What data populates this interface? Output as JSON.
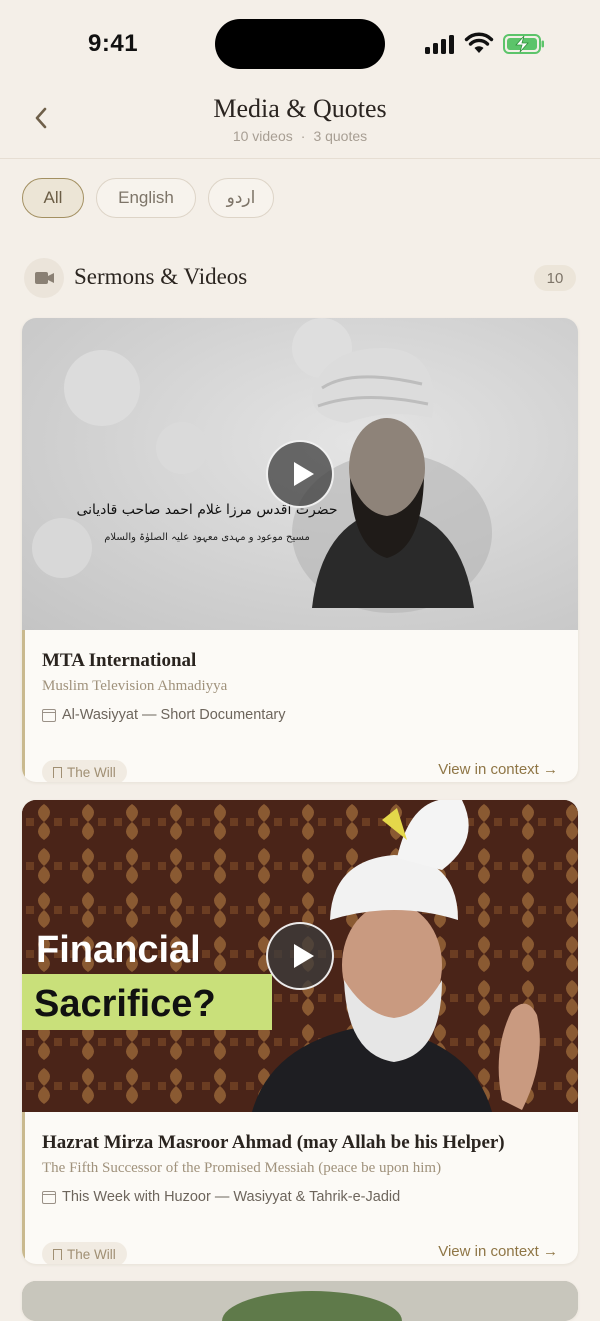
{
  "status": {
    "time": "9:41"
  },
  "header": {
    "title": "Media & Quotes",
    "videos_count": "10 videos",
    "separator": "·",
    "quotes_count": "3 quotes"
  },
  "filters": [
    {
      "label": "All",
      "active": true
    },
    {
      "label": "English",
      "active": false
    },
    {
      "label": "اردو",
      "active": false
    }
  ],
  "section": {
    "icon": "video-camera-icon",
    "title": "Sermons & Videos",
    "count": "10"
  },
  "cards": [
    {
      "title": "MTA International",
      "subtitle": "Muslim Television Ahmadiyya",
      "program": "Al-Wasiyyat — Short Documentary",
      "tag": "The Will",
      "link": "View in context →",
      "thumb_caption_line1": "حضرت اقدس مرزا غلام احمد صاحب قادیانی",
      "thumb_caption_line2": "مسیح موعود و مہدی معہود علیہ الصلوٰۃ والسلام"
    },
    {
      "title": "Hazrat Mirza Masroor Ahmad (may Allah be his Helper)",
      "subtitle": "The Fifth Successor of the Promised Messiah (peace be upon him)",
      "program": "This Week with Huzoor — Wasiyyat & Tahrik-e-Jadid",
      "tag": "The Will",
      "link": "View in context →",
      "thumb_text_line1": "Financial",
      "thumb_text_line2": "Sacrifice?"
    }
  ],
  "colors": {
    "background": "#f4efe8",
    "accent": "#8f7646",
    "card": "#fcfaf6"
  }
}
